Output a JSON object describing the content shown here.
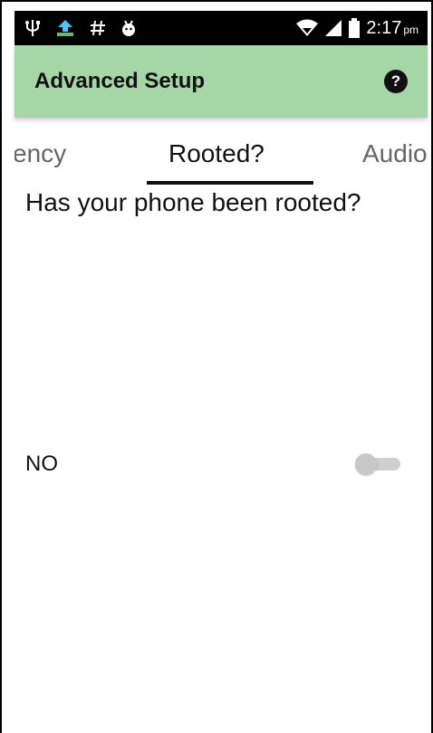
{
  "status_bar": {
    "icons": [
      "usb-icon",
      "upload-icon",
      "hash-icon",
      "android-icon"
    ],
    "glyphs": [
      "Ψ",
      "⇧",
      "#",
      "☻"
    ],
    "wifi_icon": "wifi-icon",
    "signal_icon": "signal-icon",
    "battery_icon": "battery-icon",
    "time": "2:17",
    "ampm": "pm"
  },
  "app_bar": {
    "title": "Advanced Setup",
    "help_label": "?",
    "color": "#a5d6a7"
  },
  "tabs": {
    "items": [
      {
        "label": "ency",
        "active": false
      },
      {
        "label": "Rooted?",
        "active": true
      },
      {
        "label": "Audio",
        "active": false
      }
    ]
  },
  "content": {
    "question": "Has your phone been rooted?",
    "option_label": "NO",
    "toggle_on": false
  }
}
